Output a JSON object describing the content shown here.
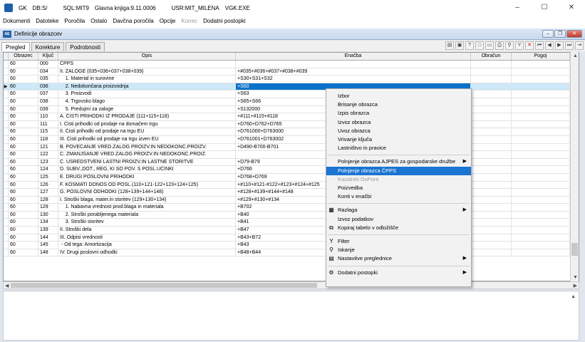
{
  "titlebar": {
    "app": "GK",
    "db": "DB:S/",
    "sql": "SQL:MIT9",
    "book": "Glavna knjiga:9.11.0006",
    "user": "USR:MIT_MILENA",
    "exe": "VGK.EXE"
  },
  "window_controls": {
    "minimize": "–",
    "maximize": "☐",
    "close": "✕"
  },
  "menu": [
    "Dokumenti",
    "Datoteke",
    "Poročila",
    "Ostalo",
    "Davčna poročila",
    "Opcije",
    "Konec",
    "Dodatni postopki"
  ],
  "menu_disabled": [
    6
  ],
  "child": {
    "title": "Definicije obrazcev",
    "icon_text": "AE"
  },
  "tabs": [
    "Pregled",
    "Korekture",
    "Podrobnosti"
  ],
  "columns": [
    "Obrazec",
    "Ključ",
    "Opis",
    "Enačba",
    "Obračun",
    "Pogoj"
  ],
  "rows": [
    {
      "obr": "60",
      "klj": "000",
      "opis": "ČPPS",
      "ena": ""
    },
    {
      "obr": "60",
      "klj": "034",
      "opis": "II. ZALOGE (035+036+037+038+039)",
      "ena": "+#035+#036+#037+#038+#039"
    },
    {
      "obr": "60",
      "klj": "035",
      "opis": "    1. Material in surovine",
      "ena": "+S30+S31+S32"
    },
    {
      "obr": "60",
      "klj": "036",
      "opis": "    2. Nedokončana proizvodnja",
      "ena": "+S60",
      "selected": true
    },
    {
      "obr": "60",
      "klj": "037",
      "opis": "    3. Proizvodi",
      "ena": "+S63"
    },
    {
      "obr": "60",
      "klj": "038",
      "opis": "    4. Trgovsko blago",
      "ena": "+S65+S66"
    },
    {
      "obr": "60",
      "klj": "039",
      "opis": "    5. Predujmi za zaloge",
      "ena": "+S132000"
    },
    {
      "obr": "60",
      "klj": "110",
      "opis": "A. ČISTI PRIHODKI IZ PRODAJE (111+115+118)",
      "ena": "+#111+#115+#118"
    },
    {
      "obr": "60",
      "klj": "111",
      "opis": "I. Čisti prihodki od prodaje na domačem trgu",
      "ena": "+D760+D762+D765"
    },
    {
      "obr": "60",
      "klj": "115",
      "opis": "II. Čisti prihodki od prodaje na trgu EU",
      "ena": "+D761000+D763000"
    },
    {
      "obr": "60",
      "klj": "118",
      "opis": "III. Čisti prihodki od prodaje na trgu izven EU",
      "ena": "+D761001+D763002"
    },
    {
      "obr": "60",
      "klj": "121",
      "opis": "B. POVEČANJE VRED.ZALOG PROIZV.IN NEDOKONČ.PROIZV.",
      "ena": "+D490-B700-B701"
    },
    {
      "obr": "60",
      "klj": "122",
      "opis": "C. ZMANJŠANJE VRED.ZALOG PROIZV.IN NEDOKONČ.PROIZ.",
      "ena": ""
    },
    {
      "obr": "60",
      "klj": "123",
      "opis": "Č. USREDSTVENI LASTNI PROIZV.IN LASTNE STORITVE",
      "ena": "+D79-B79"
    },
    {
      "obr": "60",
      "klj": "124",
      "opis": "D. SUBV.,DOT., REG, KI SO POV. S POSL.UČINKI",
      "ena": "+D766"
    },
    {
      "obr": "60",
      "klj": "125",
      "opis": "E. DRUGI POSLOVNI PRIHODKI",
      "ena": "+D768+D769"
    },
    {
      "obr": "60",
      "klj": "126",
      "opis": "F. KOSMATI DONOS OD POSL.(110+121-122+123+124+125)",
      "ena": "+#110+#121-#122+#123+#124+#125"
    },
    {
      "obr": "60",
      "klj": "127",
      "opis": "G. POSLOVNI ODHODKI (128+139+144+148)",
      "ena": "+#128+#139+#144+#148"
    },
    {
      "obr": "60",
      "klj": "128",
      "opis": "I. Stroški blaga, mater.in storitev (129+130+134)",
      "ena": "+#129+#130+#134"
    },
    {
      "obr": "60",
      "klj": "129",
      "opis": "    1. Nabavna vrednost prod.blaga in materiala",
      "ena": "+B702"
    },
    {
      "obr": "60",
      "klj": "130",
      "opis": "    2. Stroški porabljenega materiala",
      "ena": "+B40"
    },
    {
      "obr": "60",
      "klj": "134",
      "opis": "    3. Stroški storitev",
      "ena": "+B41"
    },
    {
      "obr": "60",
      "klj": "139",
      "opis": "II. Stroški dela",
      "ena": "+B47"
    },
    {
      "obr": "60",
      "klj": "144",
      "opis": "III. Odpisi vrednosti",
      "ena": "+B43+B72"
    },
    {
      "obr": "60",
      "klj": "145",
      "opis": " - Od tega: Amortizacija",
      "ena": "+B43"
    },
    {
      "obr": "60",
      "klj": "148",
      "opis": "IV. Drugi poslovni odhodki",
      "ena": "+B48+B44"
    }
  ],
  "context_menu": [
    {
      "label": "Izbor"
    },
    {
      "label": "Brisanje obrazca"
    },
    {
      "label": "Izpis obrazca"
    },
    {
      "label": "Izvoz obrazca"
    },
    {
      "label": "Uvoz obrazca"
    },
    {
      "label": "Vrivanje ključa"
    },
    {
      "label": "Lastništvo in pravice"
    },
    {
      "sep": true
    },
    {
      "label": "Polnjenje obrazca AJPES za gospodarske družbe",
      "sub": true
    },
    {
      "label": "Polnjenje obrazca ČPPS",
      "hl": true
    },
    {
      "label": "Kazalniki DuPont",
      "dis": true
    },
    {
      "label": "Poizvedba"
    },
    {
      "label": "Konti v enačbi"
    },
    {
      "sep": true
    },
    {
      "label": "Razlaga",
      "sub": true,
      "icon": "table-icon"
    },
    {
      "label": "Izvoz podatkov"
    },
    {
      "label": "Kopiraj tabelo v odložišče",
      "icon": "copy-icon"
    },
    {
      "sep": true
    },
    {
      "label": "Filter",
      "icon": "filter-icon"
    },
    {
      "label": "Iskanje",
      "icon": "search-icon"
    },
    {
      "label": "Nastavitve preglednice",
      "sub": true,
      "icon": "settings-icon"
    },
    {
      "sep": true
    },
    {
      "label": "Dodatni postopki",
      "sub": true,
      "icon": "gear-icon"
    }
  ],
  "colors": {
    "selection": "#0b72c9",
    "highlight": "#1a74d2",
    "row_selected": "#cde8f8"
  }
}
